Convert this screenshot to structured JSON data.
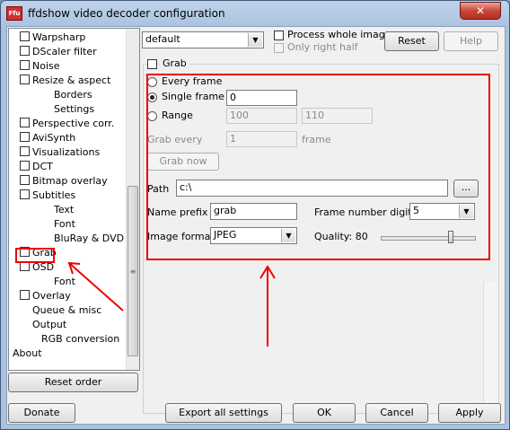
{
  "window": {
    "title": "ffdshow video decoder configuration",
    "icon_text": "Ffu",
    "close_symbol": "✕"
  },
  "sidebar": {
    "items": [
      {
        "label": "Warpsharp",
        "check": true,
        "level": 1
      },
      {
        "label": "DScaler filter",
        "check": true,
        "level": 1
      },
      {
        "label": "Noise",
        "check": true,
        "level": 1
      },
      {
        "label": "Resize & aspect",
        "check": true,
        "level": 1
      },
      {
        "label": "Borders",
        "check": false,
        "level": 3
      },
      {
        "label": "Settings",
        "check": false,
        "level": 3
      },
      {
        "label": "Perspective corr.",
        "check": true,
        "level": 1
      },
      {
        "label": "AviSynth",
        "check": true,
        "level": 1
      },
      {
        "label": "Visualizations",
        "check": true,
        "level": 1
      },
      {
        "label": "DCT",
        "check": true,
        "level": 1
      },
      {
        "label": "Bitmap overlay",
        "check": true,
        "level": 1
      },
      {
        "label": "Subtitles",
        "check": true,
        "level": 1
      },
      {
        "label": "Text",
        "check": false,
        "level": 3
      },
      {
        "label": "Font",
        "check": false,
        "level": 3
      },
      {
        "label": "BluRay & DVD",
        "check": false,
        "level": 3
      },
      {
        "label": "Grab",
        "check": true,
        "level": 1
      },
      {
        "label": "OSD",
        "check": true,
        "level": 1
      },
      {
        "label": "Font",
        "check": false,
        "level": 3
      },
      {
        "label": "Overlay",
        "check": true,
        "level": 1
      },
      {
        "label": "Queue & misc",
        "check": false,
        "level": 2
      },
      {
        "label": "Output",
        "check": false,
        "level": 2
      },
      {
        "label": "RGB conversion",
        "check": false,
        "level": 25
      },
      {
        "label": "About",
        "check": false,
        "level": 0
      }
    ],
    "reset_order": "Reset order"
  },
  "top": {
    "preset": "default",
    "process_whole_image": "Process whole image",
    "only_right_half": "Only right half",
    "reset": "Reset",
    "help": "Help"
  },
  "grab": {
    "group_title": "Grab",
    "every_frame": "Every frame",
    "single_frame": "Single frame",
    "single_frame_value": "0",
    "range": "Range",
    "range_from": "100",
    "range_to": "110",
    "grab_every": "Grab every",
    "grab_every_value": "1",
    "frame_unit": "frame",
    "grab_now": "Grab now",
    "path_label": "Path",
    "path_value": "c:\\",
    "browse": "...",
    "name_prefix_label": "Name prefix",
    "name_prefix_value": "grab",
    "frame_digits_label": "Frame number digits",
    "frame_digits_value": "5",
    "image_format_label": "Image format",
    "image_format_value": "JPEG",
    "quality_label": "Quality: 80",
    "quality": 80
  },
  "footer": {
    "donate": "Donate",
    "export": "Export all settings",
    "ok": "OK",
    "cancel": "Cancel",
    "apply": "Apply"
  },
  "colors": {
    "annotation": "#e00000",
    "title_bar": "#a9c2de"
  }
}
